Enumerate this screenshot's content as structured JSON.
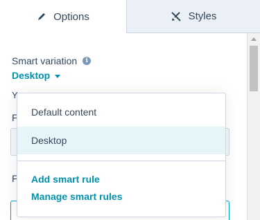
{
  "tabs": {
    "options": {
      "label": "Options",
      "icon": "pencil-icon"
    },
    "styles": {
      "label": "Styles",
      "icon": "brush-icon"
    }
  },
  "smart_variation": {
    "label": "Smart variation",
    "info_icon": "info-icon",
    "selected_value": "Desktop"
  },
  "peek": {
    "helper_text": "Yo",
    "field_label_1": "F",
    "field_label_2": "F"
  },
  "dropdown": {
    "options": [
      "Default content",
      "Desktop"
    ],
    "selected": "Desktop",
    "actions": {
      "add_rule": "Add smart rule",
      "manage_rules": "Manage smart rules"
    }
  },
  "colors": {
    "accent": "#0091ae",
    "text": "#33475b",
    "selected_bg": "#e5f5f8",
    "inactive_tab_bg": "#eaf0f6",
    "border": "#cbd6e2"
  }
}
